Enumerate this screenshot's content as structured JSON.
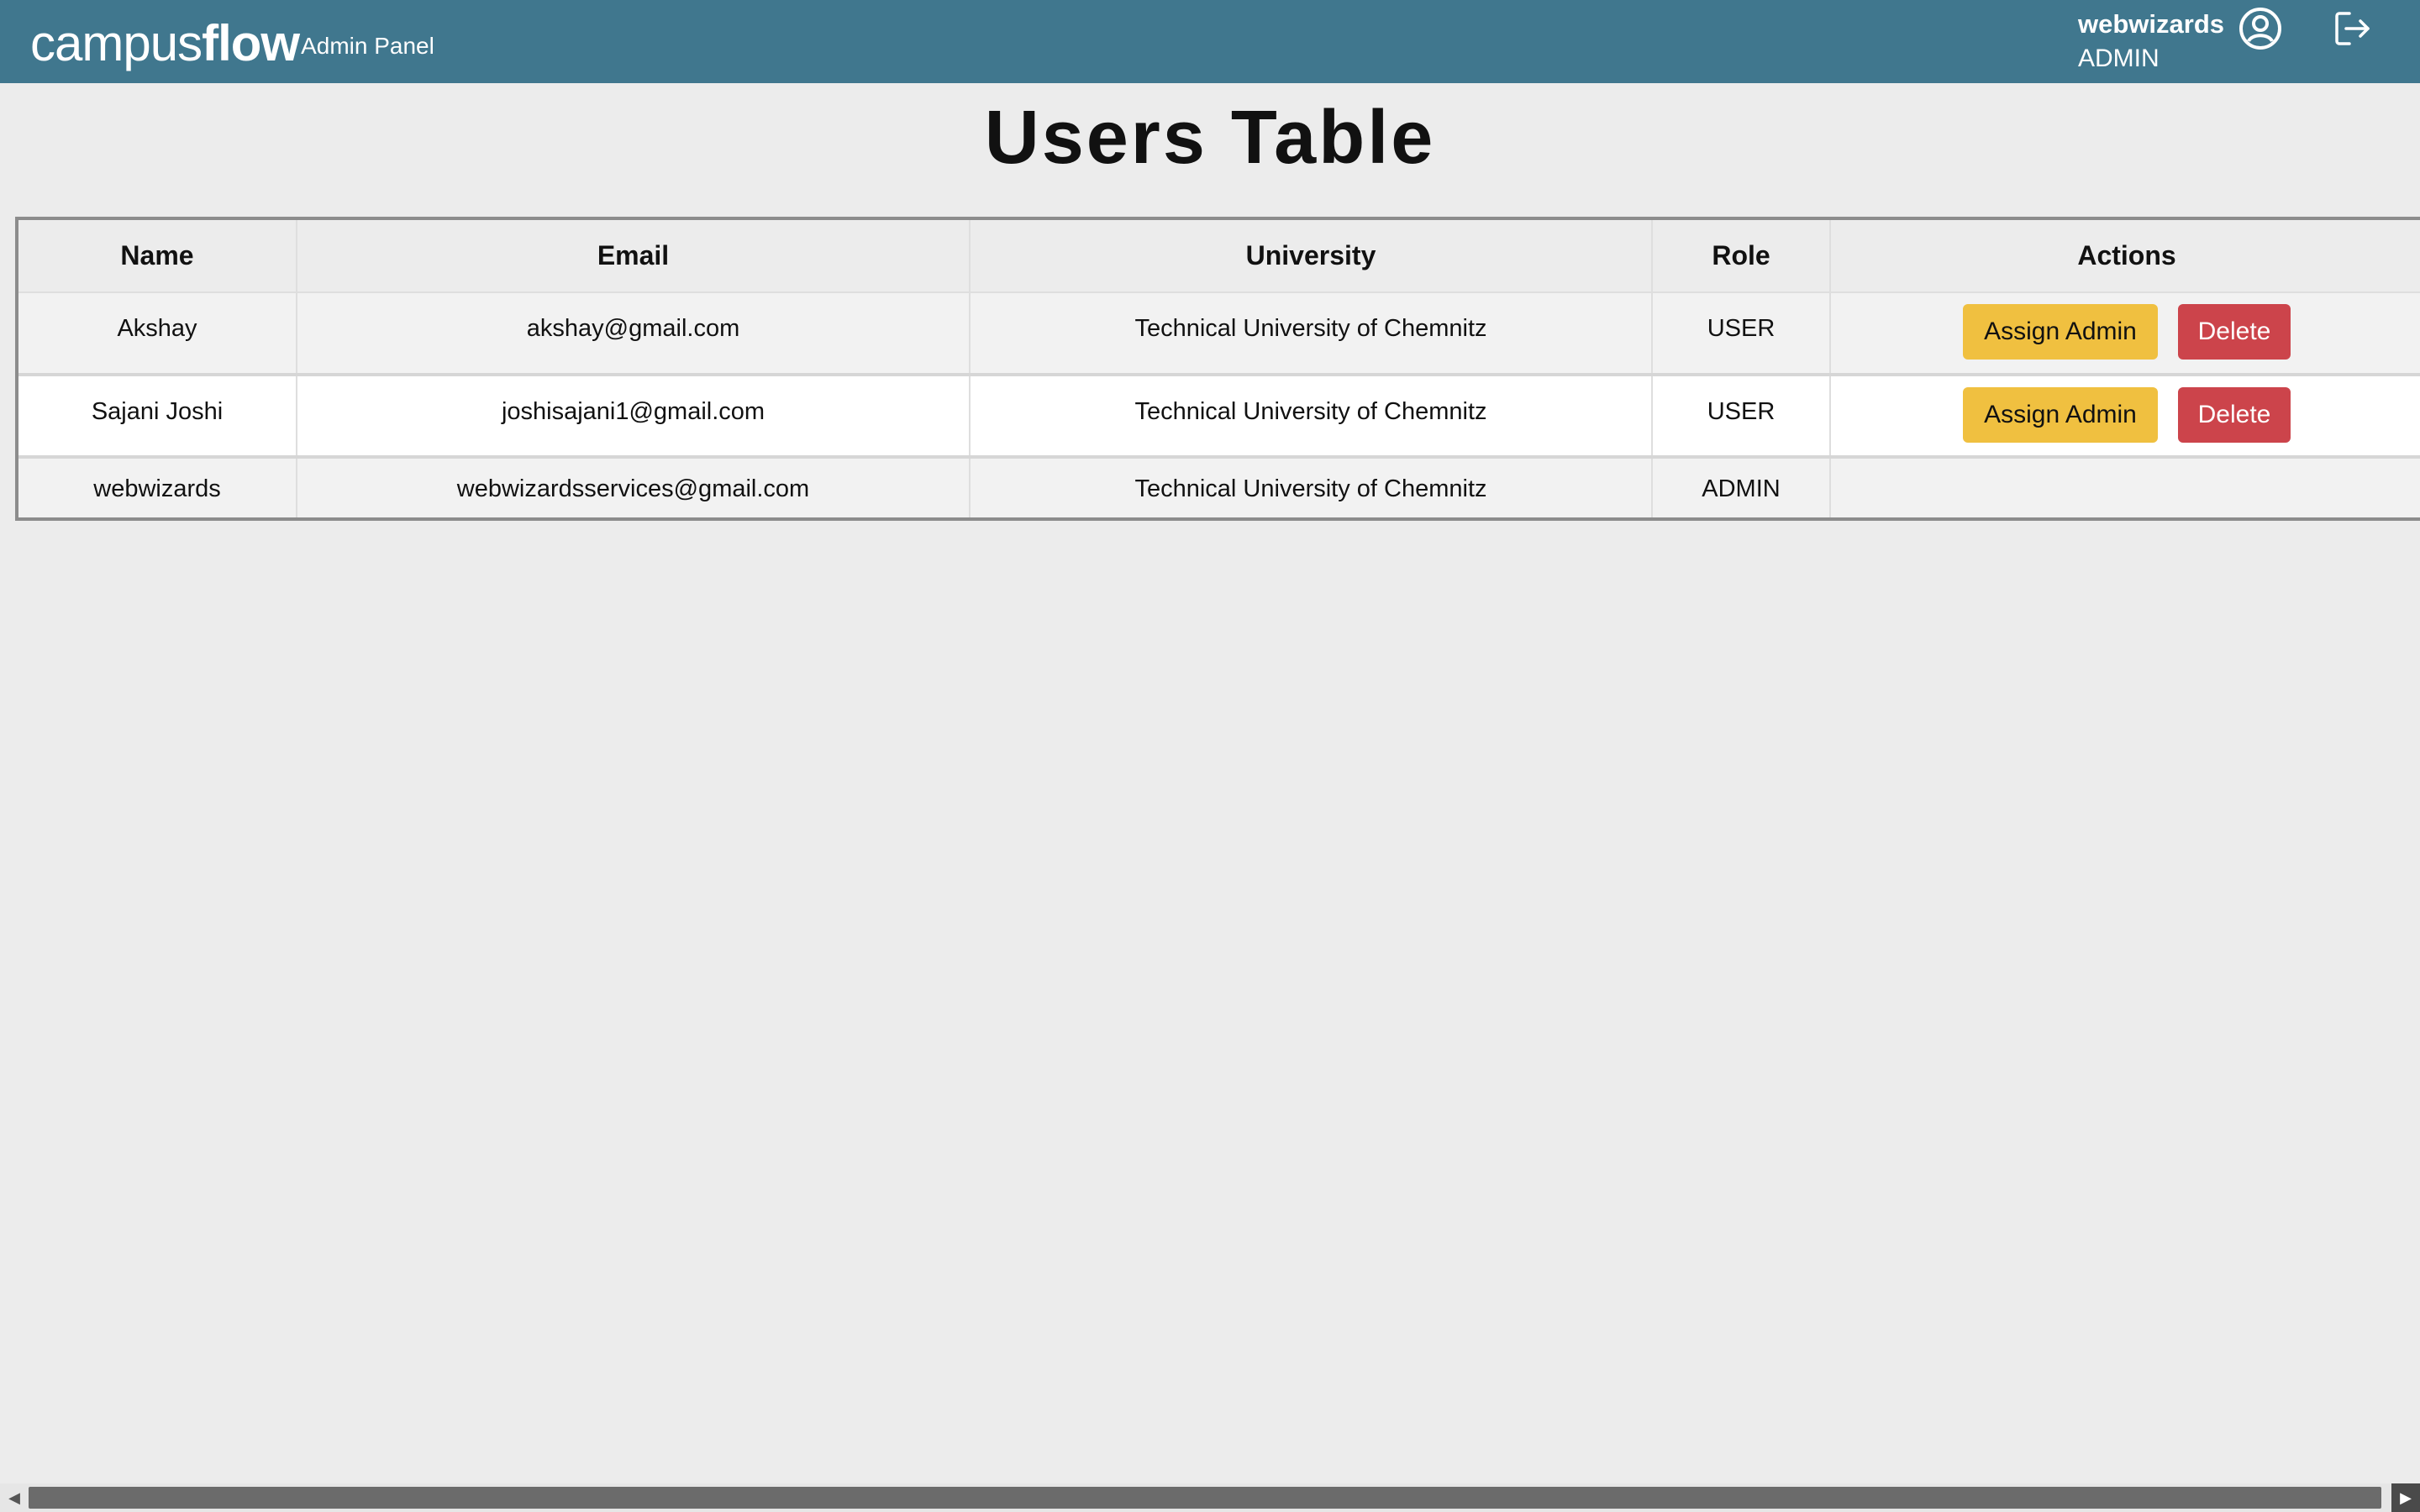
{
  "header": {
    "brand_campus": "campus",
    "brand_flow": "flow",
    "brand_subtitle": "Admin Panel",
    "user_name": "webwizards",
    "user_role": "ADMIN",
    "profile_icon": "user-circle-icon",
    "logout_icon": "logout-icon",
    "bg_color": "#40778e"
  },
  "page": {
    "title": "Users Table"
  },
  "table": {
    "columns": [
      "Name",
      "Email",
      "University",
      "Role",
      "Actions"
    ],
    "rows": [
      {
        "name": "Akshay",
        "email": "akshay@gmail.com",
        "university": "Technical University of Chemnitz",
        "role": "USER",
        "assign_label": "Assign Admin",
        "delete_label": "Delete"
      },
      {
        "name": "Sajani Joshi",
        "email": "joshisajani1@gmail.com",
        "university": "Technical University of Chemnitz",
        "role": "USER",
        "assign_label": "Assign Admin",
        "delete_label": "Delete"
      },
      {
        "name": "webwizards",
        "email": "webwizardsservices@gmail.com",
        "university": "Technical University of Chemnitz",
        "role": "ADMIN"
      }
    ]
  },
  "colors": {
    "assign_button": "#f0c040",
    "delete_button": "#cc444b",
    "page_background": "#ececec"
  },
  "scrollbar": {
    "left_arrow_icon": "caret-left-icon",
    "right_arrow_icon": "caret-right-icon"
  }
}
